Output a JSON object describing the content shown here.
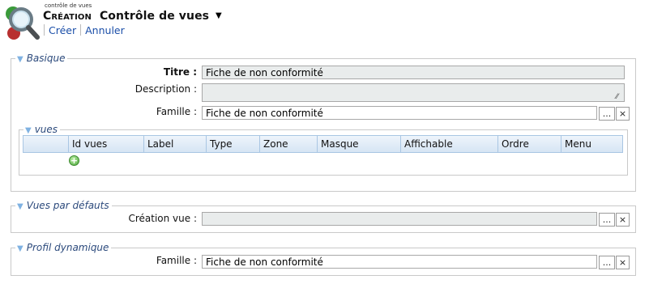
{
  "header": {
    "app_small": "contrôle de vues",
    "title_prefix": "Création",
    "title_main": "Contrôle de vues",
    "dropdown_glyph": "▼",
    "actions": {
      "create": "Créer",
      "cancel": "Annuler"
    }
  },
  "basique": {
    "legend": "Basique",
    "titre": {
      "label": "Titre :",
      "value": "Fiche de non conformité"
    },
    "description": {
      "label": "Description :",
      "value": ""
    },
    "famille": {
      "label": "Famille :",
      "value": "Fiche de non conformité"
    }
  },
  "vues": {
    "legend": "vues",
    "columns": [
      "",
      "Id vues",
      "Label",
      "Type",
      "Zone",
      "Masque",
      "Affichable",
      "Ordre",
      "Menu"
    ]
  },
  "defaults": {
    "legend": "Vues par défauts",
    "creation": {
      "label": "Création vue :",
      "value": ""
    }
  },
  "profil": {
    "legend": "Profil dynamique",
    "famille": {
      "label": "Famille :",
      "value": "Fiche de non conformité"
    }
  },
  "buttons": {
    "browse": "...",
    "clear": "×"
  },
  "legend_toggle": "▼",
  "colors": {
    "accent": "#2c4a7c",
    "link": "#1a4ea8",
    "grid_border": "#a9c6e3"
  }
}
